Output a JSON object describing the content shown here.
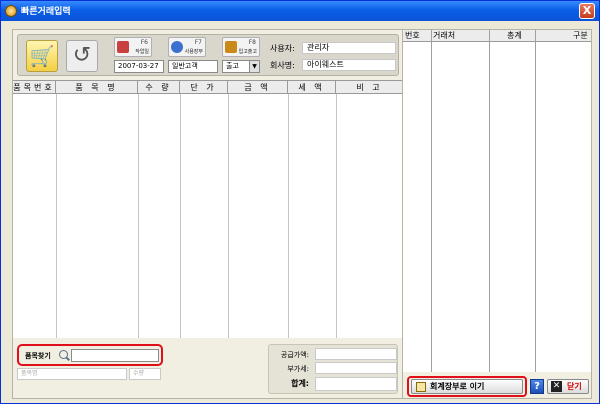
{
  "window": {
    "title": "빠른거래입력",
    "close_glyph": "X"
  },
  "toolbar": {
    "buttons": [
      {
        "key": "F6",
        "label": "작업일",
        "color": "#c94040"
      },
      {
        "key": "F7",
        "label": "사용장부",
        "color": "#3c6fcf"
      },
      {
        "key": "F8",
        "label": "입고출고",
        "color": "#c98a1a"
      }
    ],
    "date_value": "2007-03-27",
    "customer_value": "일반고객",
    "direction_value": "출고",
    "user_label": "사용자:",
    "user_value": "관리자",
    "company_label": "회사명:",
    "company_value": "아이웨스트"
  },
  "items_table": {
    "columns": [
      "품목번호",
      "품 목 명",
      "수 량",
      "단 가",
      "금 액",
      "세 액",
      "비 고"
    ]
  },
  "search": {
    "label": "품목찾기",
    "item_name_placeholder": "품목명",
    "qty_placeholder": "수량"
  },
  "totals": {
    "supply_label": "공급가액:",
    "vat_label": "부가세:",
    "sum_label": "합계:"
  },
  "right_table": {
    "columns": [
      "번호",
      "거래처",
      "총계",
      "구분"
    ]
  },
  "actions": {
    "journal_label": "회계장부로 이기",
    "help_label": "?",
    "close_label": "닫기"
  }
}
